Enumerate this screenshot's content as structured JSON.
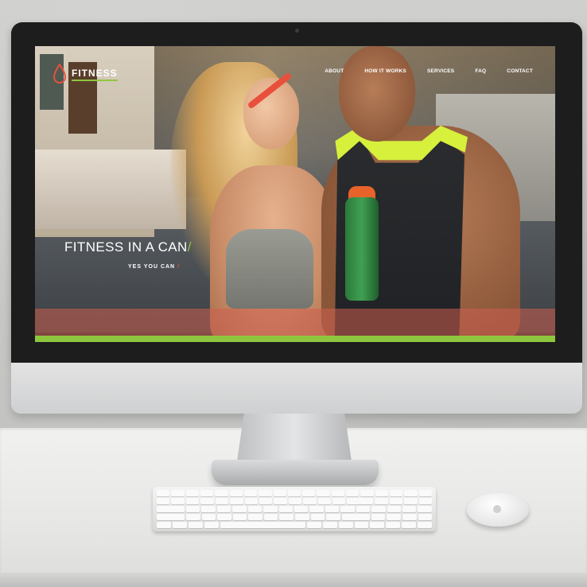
{
  "site": {
    "brand": "FITNESS",
    "brand_color": "#8fc63f",
    "accent_color": "#e8503c",
    "nav": [
      {
        "label": "ABOUT"
      },
      {
        "label": "HOW IT WORKS"
      },
      {
        "label": "SERVICES"
      },
      {
        "label": "FAQ"
      },
      {
        "label": "CONTACT"
      }
    ],
    "hero": {
      "headline": "FITNESS IN A CAN",
      "headline_slash": "/",
      "subline": "YES YOU CAN",
      "subline_slash": "/"
    }
  },
  "icons": {
    "logo": "drop-icon",
    "camera": "webcam-icon",
    "mouse_logo": "apple-logo-icon"
  }
}
